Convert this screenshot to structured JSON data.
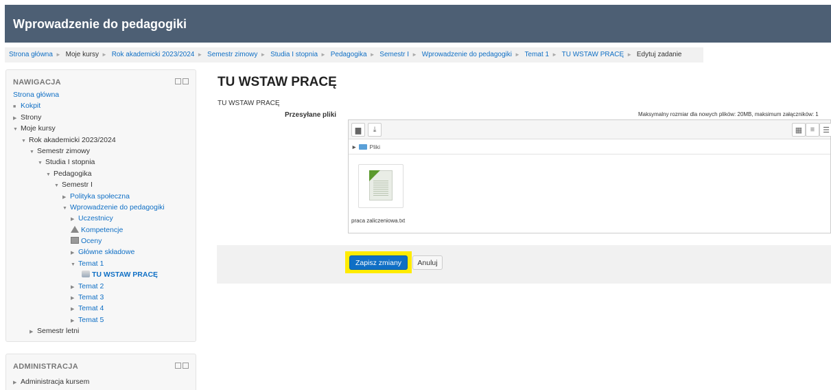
{
  "header": {
    "title": "Wprowadzenie do pedagogiki"
  },
  "breadcrumb": {
    "items": [
      "Strona główna",
      "Moje kursy",
      "Rok akademicki 2023/2024",
      "Semestr zimowy",
      "Studia I stopnia",
      "Pedagogika",
      "Semestr I",
      "Wprowadzenie do pedagogiki",
      "Temat 1",
      "TU WSTAW PRACĘ"
    ],
    "current": "Edytuj zadanie"
  },
  "navigation": {
    "title": "NAWIGACJA",
    "items": [
      {
        "label": "Strona główna"
      },
      {
        "label": "Kokpit"
      },
      {
        "label": "Strony"
      },
      {
        "label": "Moje kursy"
      },
      {
        "label": "Rok akademicki 2023/2024"
      },
      {
        "label": "Semestr zimowy"
      },
      {
        "label": "Studia I stopnia"
      },
      {
        "label": "Pedagogika"
      },
      {
        "label": "Semestr I"
      },
      {
        "label": "Polityka społeczna"
      },
      {
        "label": "Wprowadzenie do pedagogiki"
      },
      {
        "label": "Uczestnicy"
      },
      {
        "label": "Kompetencje"
      },
      {
        "label": "Oceny"
      },
      {
        "label": "Główne składowe"
      },
      {
        "label": "Temat 1"
      },
      {
        "label": "TU WSTAW PRACĘ"
      },
      {
        "label": "Temat 2"
      },
      {
        "label": "Temat 3"
      },
      {
        "label": "Temat 4"
      },
      {
        "label": "Temat 5"
      },
      {
        "label": "Semestr letni"
      }
    ]
  },
  "administration": {
    "title": "ADMINISTRACJA",
    "items": [
      {
        "label": "Administracja kursem"
      }
    ]
  },
  "main": {
    "title": "TU WSTAW PRACĘ",
    "subtitle": "TU WSTAW PRACĘ",
    "files_label": "Przesyłane pliki",
    "max_size": "Maksymalny rozmiar dla nowych plików: 20MB, maksimum załączników: 1",
    "path_folder": "Pliki",
    "file_name": "praca zaliczeniowa.txt"
  },
  "actions": {
    "save": "Zapisz zmiany",
    "cancel": "Anuluj"
  },
  "colors": {
    "header_bg": "#4d5f74",
    "link": "#0f6fc5",
    "highlight": "#ffeb00",
    "primary": "#0f6fc5"
  }
}
